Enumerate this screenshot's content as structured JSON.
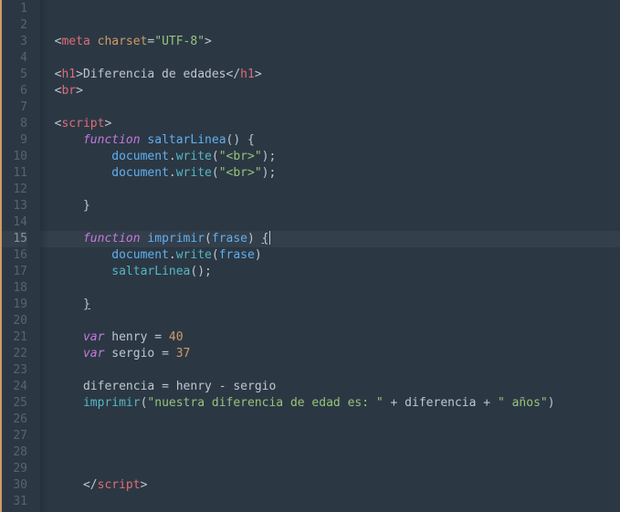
{
  "active_line_index": 14,
  "lines": [
    {
      "n": 1,
      "tokens": []
    },
    {
      "n": 2,
      "tokens": []
    },
    {
      "n": 3,
      "tokens": [
        {
          "t": "<",
          "c": "t-punc"
        },
        {
          "t": "meta ",
          "c": "t-tag"
        },
        {
          "t": "charset",
          "c": "t-attr"
        },
        {
          "t": "=",
          "c": "t-punc"
        },
        {
          "t": "\"UTF-8\"",
          "c": "t-str"
        },
        {
          "t": ">",
          "c": "t-punc"
        }
      ],
      "indent": 0
    },
    {
      "n": 4,
      "tokens": []
    },
    {
      "n": 5,
      "tokens": [
        {
          "t": "<",
          "c": "t-punc"
        },
        {
          "t": "h1",
          "c": "t-tag"
        },
        {
          "t": ">",
          "c": "t-punc"
        },
        {
          "t": "Diferencia de edades",
          "c": "t-plain"
        },
        {
          "t": "</",
          "c": "t-punc"
        },
        {
          "t": "h1",
          "c": "t-tag"
        },
        {
          "t": ">",
          "c": "t-punc"
        }
      ],
      "indent": 0
    },
    {
      "n": 6,
      "tokens": [
        {
          "t": "<",
          "c": "t-punc"
        },
        {
          "t": "br",
          "c": "t-tag"
        },
        {
          "t": ">",
          "c": "t-punc"
        }
      ],
      "indent": 0
    },
    {
      "n": 7,
      "tokens": []
    },
    {
      "n": 8,
      "tokens": [
        {
          "t": "<",
          "c": "t-punc"
        },
        {
          "t": "script",
          "c": "t-tag"
        },
        {
          "t": ">",
          "c": "t-punc"
        }
      ],
      "indent": 0
    },
    {
      "n": 9,
      "tokens": [
        {
          "t": "function",
          "c": "t-kw"
        },
        {
          "t": " ",
          "c": ""
        },
        {
          "t": "saltarLinea",
          "c": "t-fn"
        },
        {
          "t": "() {",
          "c": "t-plain"
        }
      ],
      "indent": 1
    },
    {
      "n": 10,
      "tokens": [
        {
          "t": "document",
          "c": "t-var"
        },
        {
          "t": ".",
          "c": "t-plain"
        },
        {
          "t": "write",
          "c": "t-call"
        },
        {
          "t": "(",
          "c": "t-plain"
        },
        {
          "t": "\"<br>\"",
          "c": "t-str"
        },
        {
          "t": ");",
          "c": "t-plain"
        }
      ],
      "indent": 2
    },
    {
      "n": 11,
      "tokens": [
        {
          "t": "document",
          "c": "t-var"
        },
        {
          "t": ".",
          "c": "t-plain"
        },
        {
          "t": "write",
          "c": "t-call"
        },
        {
          "t": "(",
          "c": "t-plain"
        },
        {
          "t": "\"<br>\"",
          "c": "t-str"
        },
        {
          "t": ");",
          "c": "t-plain"
        }
      ],
      "indent": 2
    },
    {
      "n": 12,
      "tokens": []
    },
    {
      "n": 13,
      "tokens": [
        {
          "t": "}",
          "c": "t-plain"
        }
      ],
      "indent": 1
    },
    {
      "n": 14,
      "tokens": []
    },
    {
      "n": 15,
      "tokens": [
        {
          "t": "function",
          "c": "t-kw"
        },
        {
          "t": " ",
          "c": ""
        },
        {
          "t": "imprimir",
          "c": "t-fn"
        },
        {
          "t": "(",
          "c": "t-plain"
        },
        {
          "t": "frase",
          "c": "t-var"
        },
        {
          "t": ") ",
          "c": "t-plain"
        },
        {
          "t": "{",
          "c": "t-plain",
          "u": true
        },
        {
          "t": "CURSOR",
          "c": "cursor"
        }
      ],
      "indent": 1
    },
    {
      "n": 16,
      "tokens": [
        {
          "t": "document",
          "c": "t-var"
        },
        {
          "t": ".",
          "c": "t-plain"
        },
        {
          "t": "write",
          "c": "t-call"
        },
        {
          "t": "(",
          "c": "t-plain"
        },
        {
          "t": "frase",
          "c": "t-var"
        },
        {
          "t": ")",
          "c": "t-plain"
        }
      ],
      "indent": 2
    },
    {
      "n": 17,
      "tokens": [
        {
          "t": "saltarLinea",
          "c": "t-call"
        },
        {
          "t": "();",
          "c": "t-plain"
        }
      ],
      "indent": 2
    },
    {
      "n": 18,
      "tokens": []
    },
    {
      "n": 19,
      "tokens": [
        {
          "t": "}",
          "c": "t-plain",
          "u": true
        }
      ],
      "indent": 1
    },
    {
      "n": 20,
      "tokens": []
    },
    {
      "n": 21,
      "tokens": [
        {
          "t": "var",
          "c": "t-kw"
        },
        {
          "t": " henry ",
          "c": "t-plain"
        },
        {
          "t": "=",
          "c": "t-punc"
        },
        {
          "t": " ",
          "c": ""
        },
        {
          "t": "40",
          "c": "t-num"
        }
      ],
      "indent": 1
    },
    {
      "n": 22,
      "tokens": [
        {
          "t": "var",
          "c": "t-kw"
        },
        {
          "t": " sergio ",
          "c": "t-plain"
        },
        {
          "t": "=",
          "c": "t-punc"
        },
        {
          "t": " ",
          "c": ""
        },
        {
          "t": "37",
          "c": "t-num"
        }
      ],
      "indent": 1
    },
    {
      "n": 23,
      "tokens": []
    },
    {
      "n": 24,
      "tokens": [
        {
          "t": "diferencia ",
          "c": "t-plain"
        },
        {
          "t": "=",
          "c": "t-punc"
        },
        {
          "t": " henry ",
          "c": "t-plain"
        },
        {
          "t": "-",
          "c": "t-punc"
        },
        {
          "t": " sergio",
          "c": "t-plain"
        }
      ],
      "indent": 1
    },
    {
      "n": 25,
      "tokens": [
        {
          "t": "imprimir",
          "c": "t-call"
        },
        {
          "t": "(",
          "c": "t-plain"
        },
        {
          "t": "\"nuestra diferencia de edad es: \"",
          "c": "t-str"
        },
        {
          "t": " ",
          "c": ""
        },
        {
          "t": "+",
          "c": "t-punc"
        },
        {
          "t": " diferencia ",
          "c": "t-plain"
        },
        {
          "t": "+",
          "c": "t-punc"
        },
        {
          "t": " ",
          "c": ""
        },
        {
          "t": "\" años\"",
          "c": "t-str"
        },
        {
          "t": ")",
          "c": "t-plain"
        }
      ],
      "indent": 1
    },
    {
      "n": 26,
      "tokens": []
    },
    {
      "n": 27,
      "tokens": []
    },
    {
      "n": 28,
      "tokens": []
    },
    {
      "n": 29,
      "tokens": []
    },
    {
      "n": 30,
      "tokens": [
        {
          "t": "</",
          "c": "t-punc"
        },
        {
          "t": "script",
          "c": "t-tag"
        },
        {
          "t": ">",
          "c": "t-punc"
        }
      ],
      "indent": 1
    },
    {
      "n": 31,
      "tokens": []
    }
  ]
}
